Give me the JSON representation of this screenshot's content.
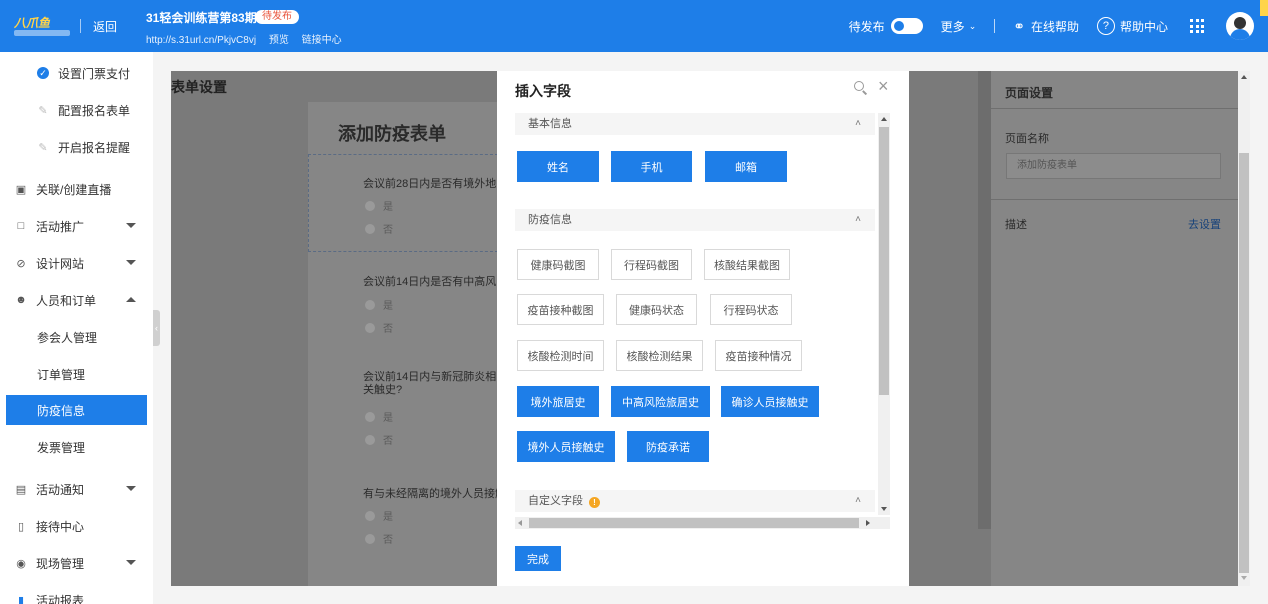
{
  "header": {
    "logo_text": "八爪鱼",
    "back_label": "返回",
    "event_title": "31轻会训练营第83期",
    "status_badge": "待发布",
    "event_url": "http://s.31url.cn/PkjvC8vj",
    "preview_link": "预览",
    "link_center": "链接中心",
    "publish_label": "待发布",
    "more_label": "更多",
    "online_help": "在线帮助",
    "help_center": "帮助中心"
  },
  "sidebar": {
    "items": [
      {
        "label": "设置门票支付"
      },
      {
        "label": "配置报名表单"
      },
      {
        "label": "开启报名提醒"
      },
      {
        "label": "关联/创建直播"
      },
      {
        "label": "活动推广"
      },
      {
        "label": "设计网站"
      },
      {
        "label": "人员和订单"
      },
      {
        "label": "参会人管理"
      },
      {
        "label": "订单管理"
      },
      {
        "label": "防疫信息"
      },
      {
        "label": "发票管理"
      },
      {
        "label": "活动通知"
      },
      {
        "label": "接待中心"
      },
      {
        "label": "现场管理"
      },
      {
        "label": "活动报表"
      }
    ]
  },
  "editor": {
    "panel_title": "表单设置",
    "form_title": "添加防疫表单",
    "questions": [
      {
        "text": "会议前28日内是否有境外地区",
        "options": [
          "是",
          "否"
        ]
      },
      {
        "text": "会议前14日内是否有中高风险",
        "options": [
          "是",
          "否"
        ]
      },
      {
        "text": "会议前14日内与新冠肺炎相关触史?",
        "options": [
          "是",
          "否"
        ]
      },
      {
        "text": "有与未经隔离的境外人员接触",
        "options": [
          "是",
          "否"
        ]
      }
    ]
  },
  "right_panel": {
    "title": "页面设置",
    "name_label": "页面名称",
    "name_placeholder": "添加防疫表单",
    "desc_label": "描述",
    "desc_link": "去设置"
  },
  "modal": {
    "title": "插入字段",
    "sections": {
      "basic": {
        "title": "基本信息",
        "fields": [
          "姓名",
          "手机",
          "邮箱"
        ]
      },
      "epidemic": {
        "title": "防疫信息",
        "fields": [
          "健康码截图",
          "行程码截图",
          "核酸结果截图",
          "疫苗接种截图",
          "健康码状态",
          "行程码状态",
          "核酸检测时间",
          "核酸检测结果",
          "疫苗接种情况",
          "境外旅居史",
          "中高风险旅居史",
          "确诊人员接触史",
          "境外人员接触史",
          "防疫承诺"
        ]
      },
      "custom": {
        "title": "自定义字段"
      }
    },
    "done_label": "完成"
  },
  "colors": {
    "primary": "#1e7ee8",
    "badge_text": "#e8553c",
    "warning": "#f5a623"
  }
}
